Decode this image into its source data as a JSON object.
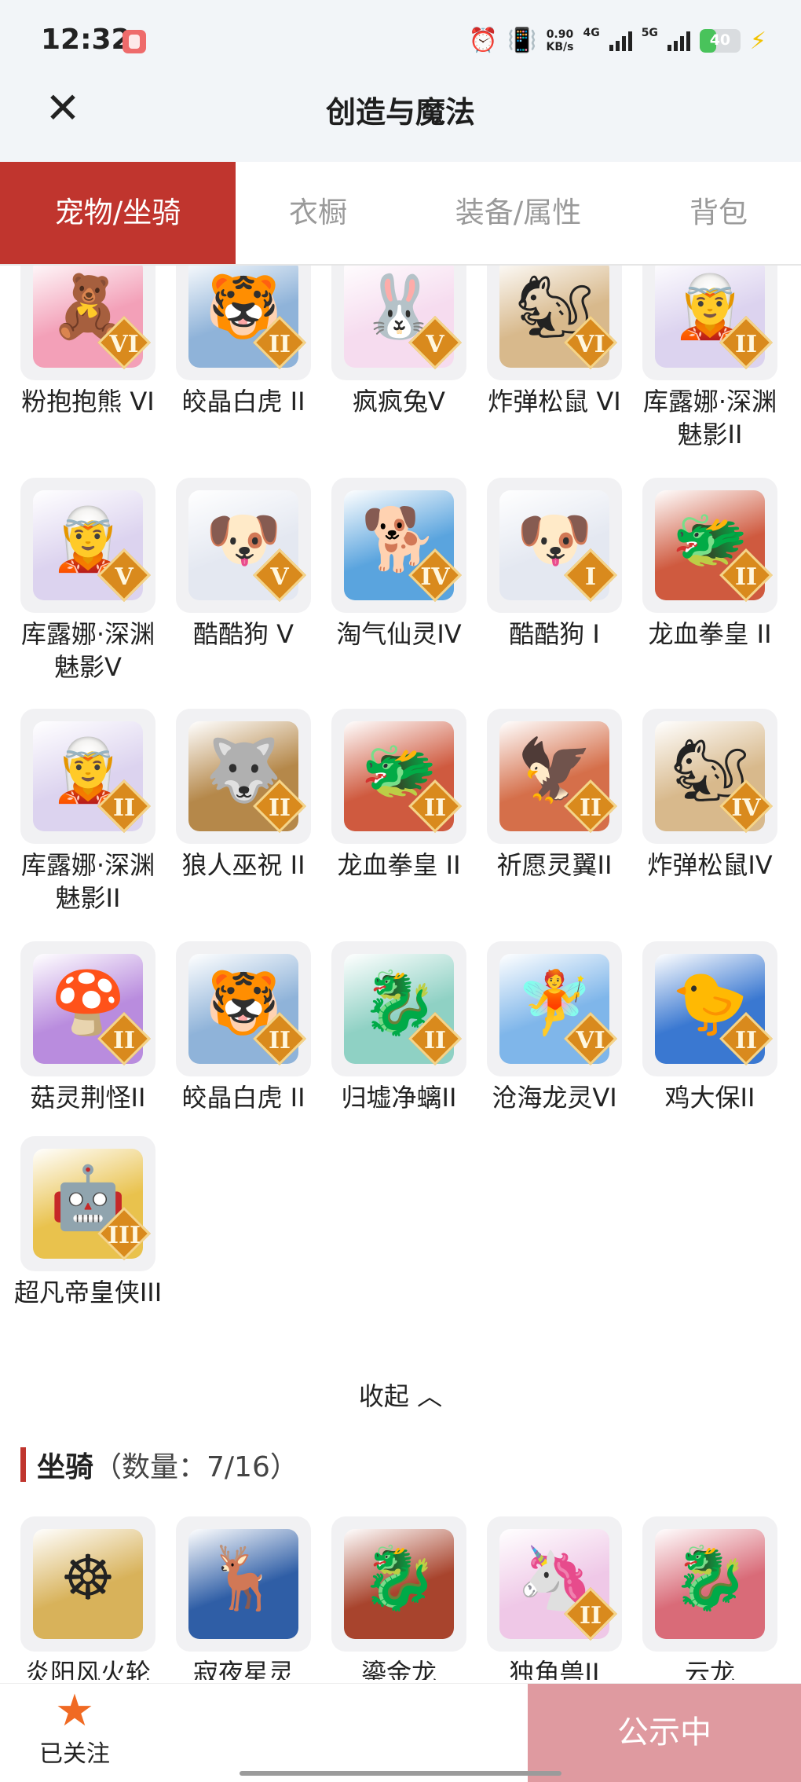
{
  "status_bar": {
    "time": "12:32",
    "net_speed": "0.90",
    "net_speed_unit": "KB/s",
    "network1": "4G",
    "network2": "5G",
    "battery": "40",
    "battery_level": 0.4
  },
  "header": {
    "title": "创造与魔法"
  },
  "tabs": [
    {
      "label": "宠物/坐骑",
      "active": true
    },
    {
      "label": "衣橱",
      "active": false
    },
    {
      "label": "装备/属性",
      "active": false
    },
    {
      "label": "背包",
      "active": false
    }
  ],
  "pets": [
    {
      "name": "粉抱抱熊 VI",
      "badge": "VI",
      "glyph": "🧸",
      "color": "#f3a0b8"
    },
    {
      "name": "皎晶白虎 II",
      "badge": "II",
      "glyph": "🐯",
      "color": "#8fb3d9"
    },
    {
      "name": "疯疯兔V",
      "badge": "V",
      "glyph": "🐰",
      "color": "#f6dcef"
    },
    {
      "name": "炸弹松鼠 VI",
      "badge": "VI",
      "glyph": "🐿",
      "color": "#d8b98c"
    },
    {
      "name": "库露娜·深渊魅影II",
      "badge": "II",
      "glyph": "🧝",
      "color": "#dcd3ef"
    },
    {
      "name": "库露娜·深渊魅影V",
      "badge": "V",
      "glyph": "🧝",
      "color": "#dcd3ef"
    },
    {
      "name": "酷酷狗 V",
      "badge": "V",
      "glyph": "🐶",
      "color": "#e4e8f1"
    },
    {
      "name": "淘气仙灵IV",
      "badge": "IV",
      "glyph": "🐕",
      "color": "#5aa4de"
    },
    {
      "name": "酷酷狗 I",
      "badge": "I",
      "glyph": "🐶",
      "color": "#e4e8f1"
    },
    {
      "name": "龙血拳皇 II",
      "badge": "II",
      "glyph": "🐲",
      "color": "#cf5a3f"
    },
    {
      "name": "库露娜·深渊魅影II",
      "badge": "II",
      "glyph": "🧝",
      "color": "#dcd3ef"
    },
    {
      "name": "狼人巫祝 II",
      "badge": "II",
      "glyph": "🐺",
      "color": "#b5884a"
    },
    {
      "name": "龙血拳皇 II",
      "badge": "II",
      "glyph": "🐲",
      "color": "#cf5a3f"
    },
    {
      "name": "祈愿灵翼II",
      "badge": "II",
      "glyph": "🦅",
      "color": "#d56f4a"
    },
    {
      "name": "炸弹松鼠IV",
      "badge": "IV",
      "glyph": "🐿",
      "color": "#d8b98c"
    },
    {
      "name": "菇灵荆怪II",
      "badge": "II",
      "glyph": "🍄",
      "color": "#b98cde"
    },
    {
      "name": "皎晶白虎 II",
      "badge": "II",
      "glyph": "🐯",
      "color": "#8fb3d9"
    },
    {
      "name": "归墟净螭II",
      "badge": "II",
      "glyph": "🐉",
      "color": "#8fd1c4"
    },
    {
      "name": "沧海龙灵VI",
      "badge": "VI",
      "glyph": "🧚",
      "color": "#7fb6ea"
    },
    {
      "name": "鸡大保II",
      "badge": "II",
      "glyph": "🐤",
      "color": "#3a78d1"
    },
    {
      "name": "超凡帝皇侠III",
      "badge": "III",
      "glyph": "🤖",
      "color": "#e9c24d"
    }
  ],
  "collapse": {
    "label": "收起",
    "icon": "chevron-up-icon"
  },
  "mounts_section": {
    "title": "坐骑",
    "count": "（数量：7/16）"
  },
  "mounts": [
    {
      "name": "炎阳风火轮",
      "badge": "",
      "glyph": "☸",
      "color": "#d8b25a"
    },
    {
      "name": "寂夜星灵",
      "badge": "",
      "glyph": "🦌",
      "color": "#2f5ea6"
    },
    {
      "name": "鎏金龙",
      "badge": "",
      "glyph": "🐉",
      "color": "#a8442d"
    },
    {
      "name": "独角兽II",
      "badge": "II",
      "glyph": "🦄",
      "color": "#efc8e7"
    },
    {
      "name": "云龙",
      "badge": "",
      "glyph": "🐉",
      "color": "#d96b78"
    }
  ],
  "footer": {
    "follow_label": "已关注",
    "follow_icon": "star-icon",
    "publish_label": "公示中"
  },
  "colors": {
    "accent": "#c0352e",
    "publish": "#df9aa0",
    "star": "#f06a23"
  }
}
